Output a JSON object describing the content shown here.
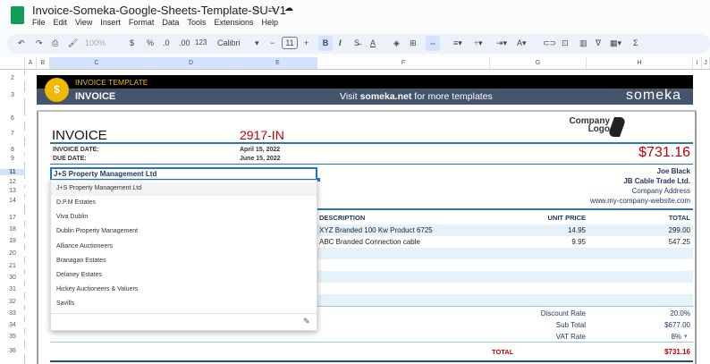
{
  "app": {
    "title": "Invoice-Someka-Google-Sheets-Template-SU-V1",
    "menu": [
      "File",
      "Edit",
      "View",
      "Insert",
      "Format",
      "Data",
      "Tools",
      "Extensions",
      "Help"
    ]
  },
  "toolbar": {
    "zoom": "100%",
    "currency": "$",
    "percent": "%",
    "dec_less": ".0",
    "dec_more": ".00",
    "format_123": "123",
    "font": "Calibri",
    "font_size": "11",
    "bold": "B",
    "italic": "I",
    "sum": "Σ"
  },
  "columns": [
    "A",
    "B",
    "C",
    "D",
    "E",
    "F",
    "G",
    "H",
    "I",
    "J"
  ],
  "rows": [
    "1",
    "2",
    "3",
    "6",
    "7",
    "8",
    "9",
    "11",
    "12",
    "13",
    "14",
    "17",
    "18",
    "19",
    "20",
    "21",
    "30",
    "31",
    "32",
    "33",
    "34",
    "35",
    "36"
  ],
  "banner": {
    "subtitle": "INVOICE TEMPLATE",
    "title": "INVOICE",
    "visit_pre": "Visit ",
    "visit_link": "someka.net",
    "visit_post": " for more templates",
    "brand": "someka"
  },
  "invoice": {
    "heading": "INVOICE",
    "number": "2917-IN",
    "logo_line1": "Company",
    "logo_line2": "Logo",
    "total_big": "$731.16",
    "invoice_date_label": "INVOICE DATE:",
    "invoice_date": "April 15, 2022",
    "due_date_label": "DUE DATE:",
    "due_date": "June 15, 2022",
    "client_input": "J+S Property Management Ltd",
    "contact": {
      "name": "Joe Black",
      "company": "JB Cable Trade Ltd.",
      "address": "Company Address",
      "website": "www.my-company-website.com"
    },
    "table": {
      "headers": [
        "DESCRIPTION",
        "UNIT PRICE",
        "TOTAL"
      ],
      "rows": [
        [
          "XYZ Branded 100 Kw Product 6725",
          "14.95",
          "299.00"
        ],
        [
          "ABC Branded Connection cable",
          "9.95",
          "547.25"
        ]
      ]
    },
    "summary": [
      {
        "label": "Discount Rate",
        "value": "20.0%"
      },
      {
        "label": "Sub Total",
        "value": "$677.00"
      },
      {
        "label": "VAT Rate",
        "value": "8%"
      }
    ],
    "total_label": "TOTAL",
    "total_value": "$731.16"
  },
  "dropdown": {
    "options": [
      "J+S Property Management Ltd",
      "D.P.M Estates",
      "Viva Dublin",
      "Dublin Property Management",
      "Alliance Auctioneers",
      "Branagan Estates",
      "Delaney Estates",
      "Hickey Auctioneers & Valuers",
      "Savills"
    ]
  },
  "colors": {
    "accent_red": "#c00000",
    "banner_slate": "#44546a",
    "banner_gold": "#f2b800",
    "link_blue": "#1f3864",
    "stripe": "#e6f2fa"
  }
}
